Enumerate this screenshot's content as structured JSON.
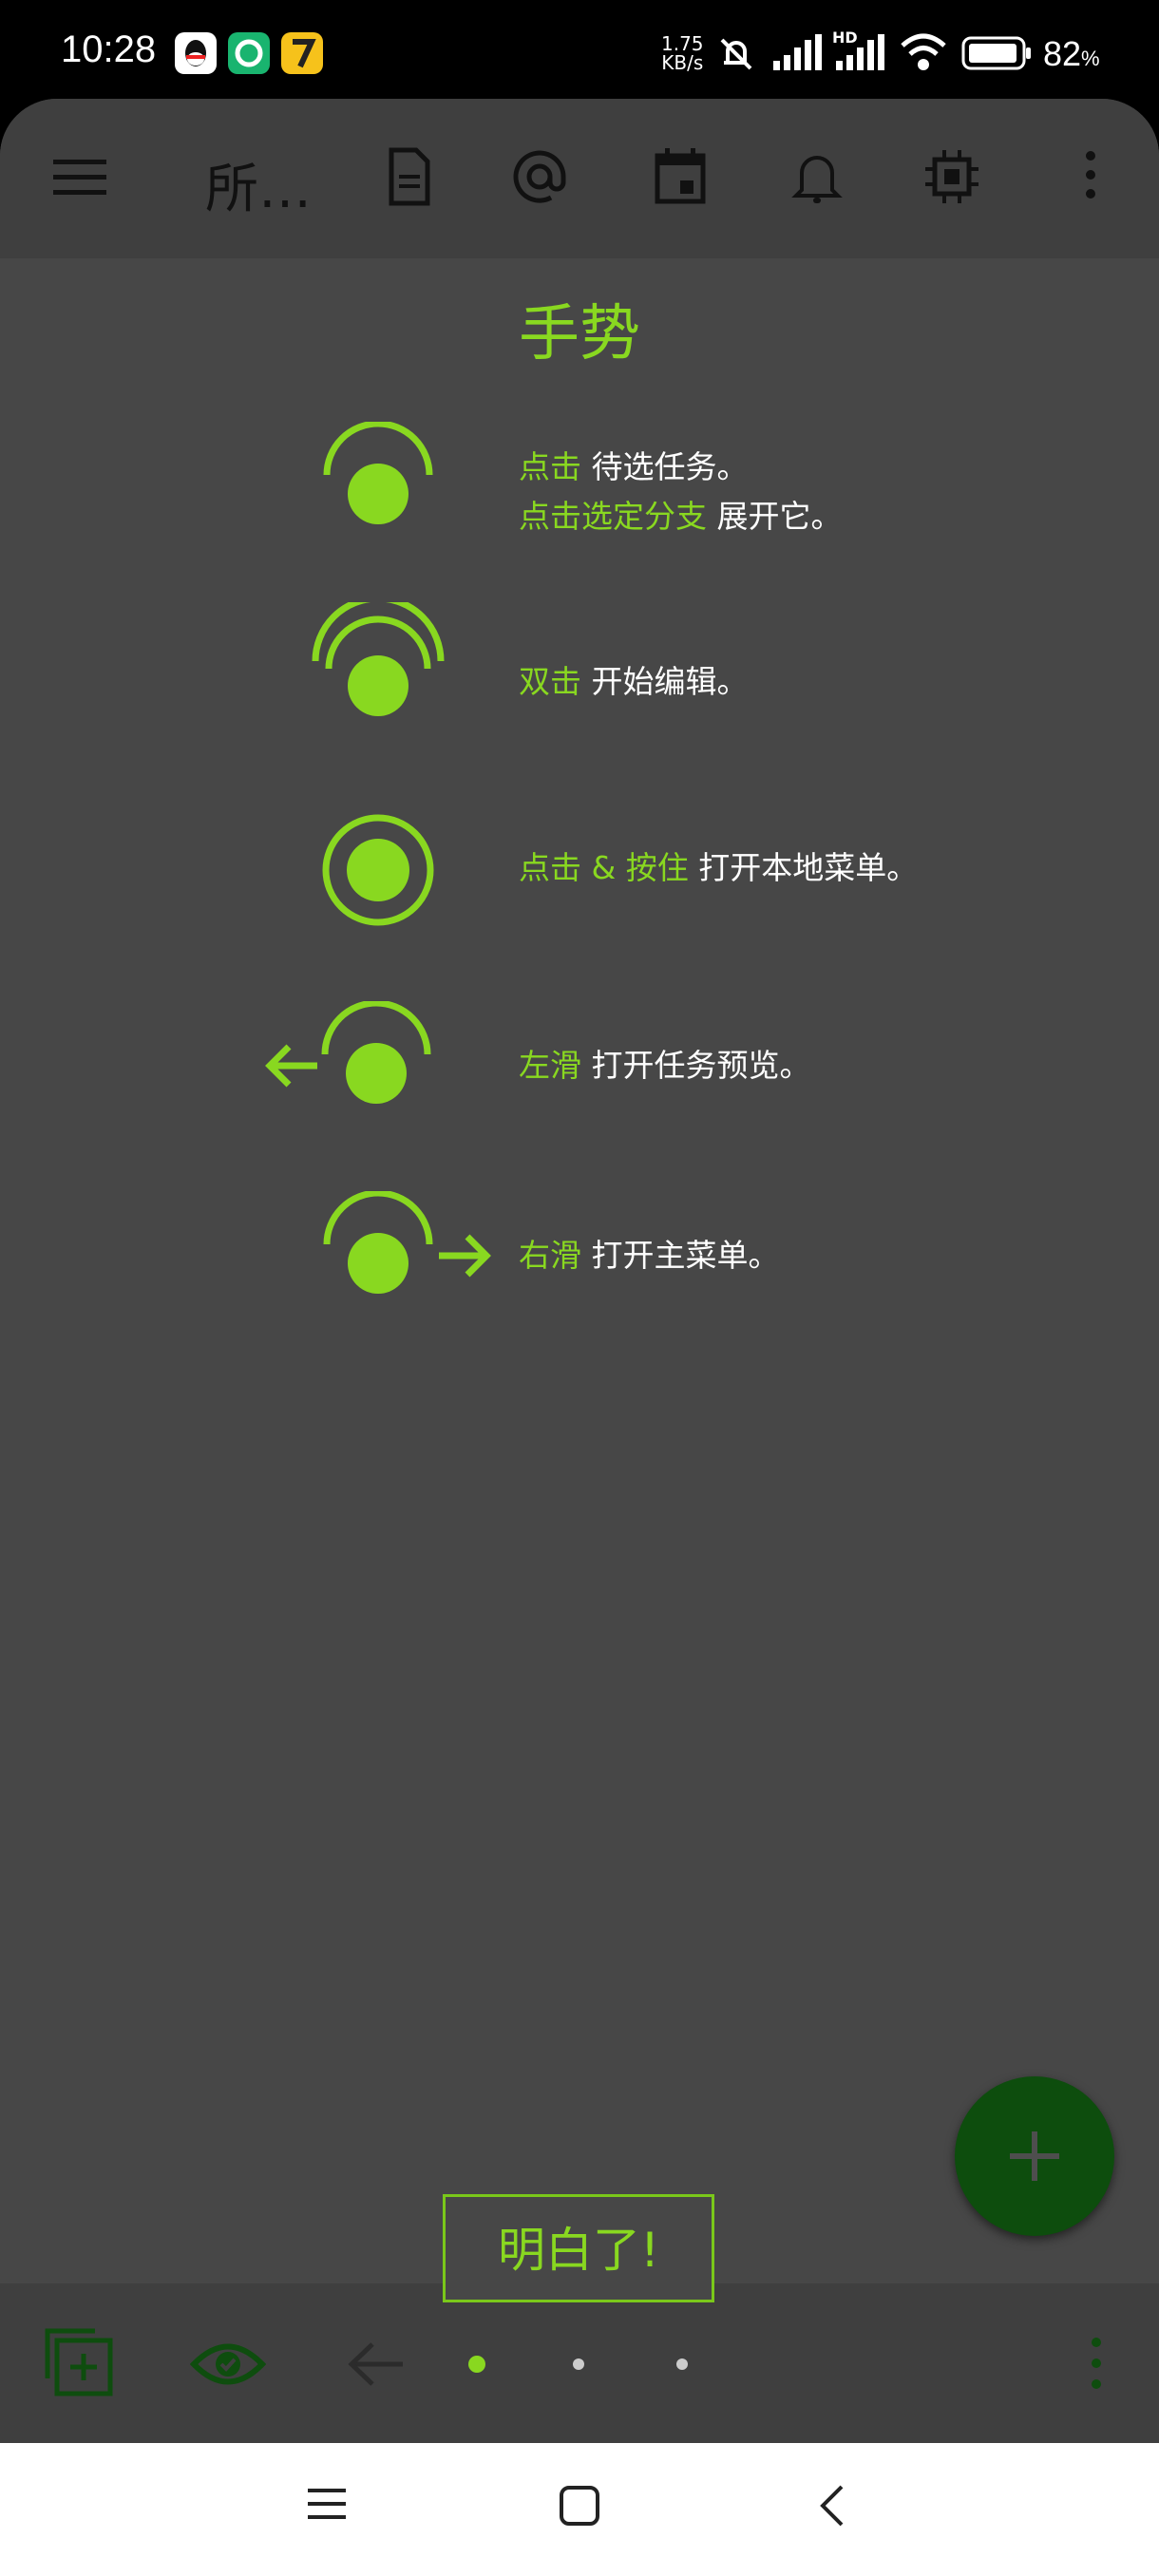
{
  "status_bar": {
    "time": "10:28",
    "net_speed_value": "1.75",
    "net_speed_unit": "KB/s",
    "hd_label": "HD",
    "battery": "82",
    "battery_unit": "%",
    "notif_icons": [
      "qq-icon",
      "green-app-icon",
      "yellow-seven-icon"
    ]
  },
  "appbar": {
    "title": "所…",
    "icons": [
      "menu-icon",
      "document-icon",
      "at-icon",
      "calendar-icon",
      "bell-icon",
      "chip-icon",
      "more-vert-icon"
    ]
  },
  "gestures": {
    "title": "手势",
    "items": [
      {
        "icon": "tap-icon",
        "lines": [
          {
            "green": "点击",
            "white": " 待选任务。"
          },
          {
            "green": "点击选定分支",
            "white": " 展开它。"
          }
        ]
      },
      {
        "icon": "double-tap-icon",
        "lines": [
          {
            "green": "双击",
            "white": " 开始编辑。"
          }
        ]
      },
      {
        "icon": "tap-hold-icon",
        "lines": [
          {
            "green": "点击 & 按住",
            "white": " 打开本地菜单。"
          }
        ]
      },
      {
        "icon": "swipe-left-icon",
        "lines": [
          {
            "green": "左滑",
            "white": " 打开任务预览。"
          }
        ]
      },
      {
        "icon": "swipe-right-icon",
        "lines": [
          {
            "green": "右滑",
            "white": " 打开主菜单。"
          }
        ]
      }
    ],
    "dismiss_label": "明白了!"
  },
  "fab": {
    "icon": "plus-icon"
  },
  "bottom_bar": {
    "icons": [
      "add-copy-icon",
      "eye-check-icon",
      "back-arrow-icon"
    ],
    "page_indicator": {
      "count": 3,
      "active": 1
    },
    "more_icon": "more-vert-icon"
  },
  "colors": {
    "accent": "#89d820",
    "background": "#474747",
    "bar": "#3f3f3f",
    "fab": "#0d4d0d"
  }
}
